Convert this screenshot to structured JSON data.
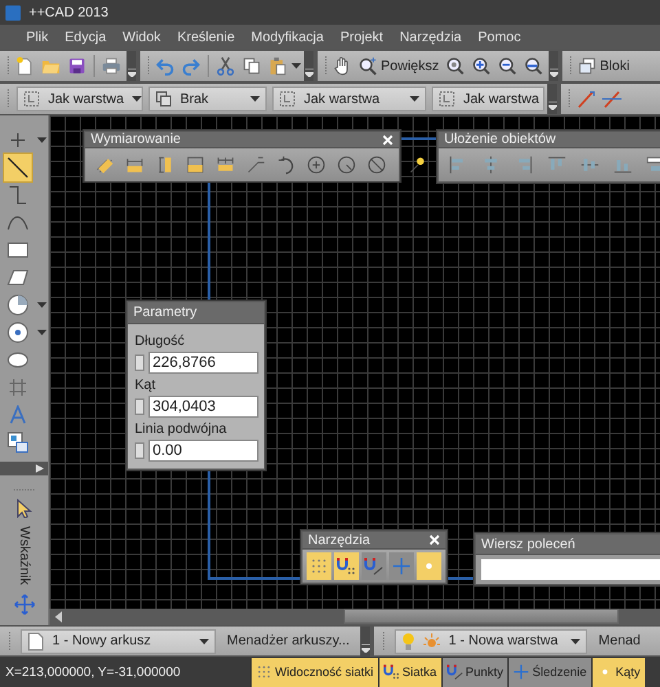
{
  "window": {
    "title": "++CAD 2013"
  },
  "menu": [
    "Plik",
    "Edycja",
    "Widok",
    "Kreślenie",
    "Modyfikacja",
    "Projekt",
    "Narzędzia",
    "Pomoc"
  ],
  "zoom_button": {
    "label": "Powiększ"
  },
  "blocks_button": {
    "label": "Bloki"
  },
  "property_combos": [
    {
      "kind": "layer",
      "value": "Jak warstwa"
    },
    {
      "kind": "stack",
      "value": "Brak"
    },
    {
      "kind": "layer",
      "value": "Jak warstwa"
    },
    {
      "kind": "layer",
      "value": "Jak warstwa"
    }
  ],
  "left_tools": [
    {
      "kind": "point",
      "selected": false
    },
    {
      "kind": "line",
      "selected": true
    },
    {
      "kind": "polyline",
      "selected": false
    },
    {
      "kind": "arc",
      "selected": false
    },
    {
      "kind": "rectangle",
      "selected": false
    },
    {
      "kind": "parallelogram",
      "selected": false
    },
    {
      "kind": "pie",
      "selected": false
    },
    {
      "kind": "circle",
      "selected": false
    },
    {
      "kind": "ellipse",
      "selected": false
    },
    {
      "kind": "hatch",
      "selected": false
    },
    {
      "kind": "text",
      "selected": false
    },
    {
      "kind": "image",
      "selected": false
    }
  ],
  "pointer_tool": {
    "label": "Wskaźnik"
  },
  "dimension_panel": {
    "title": "Wymiarowanie"
  },
  "arrange_panel": {
    "title": "Ułożenie obiektów"
  },
  "parameters_panel": {
    "title": "Parametry",
    "fields": [
      {
        "label": "Długość",
        "checked": false,
        "value": "226,8766"
      },
      {
        "label": "Kąt",
        "checked": false,
        "value": "304,0403"
      },
      {
        "label": "Linia podwójna",
        "checked": false,
        "value": "0.00"
      }
    ]
  },
  "tools_panel": {
    "title": "Narzędzia",
    "toggles": [
      {
        "kind": "grid",
        "on": true
      },
      {
        "kind": "snap",
        "on": true
      },
      {
        "kind": "points",
        "on": false
      },
      {
        "kind": "tracking",
        "on": false
      },
      {
        "kind": "angles",
        "on": true
      }
    ]
  },
  "command_panel": {
    "title": "Wiersz poleceń"
  },
  "sheet_bar": {
    "sheet": "1 - Nowy arkusz",
    "sheet_manager": "Menadżer arkuszy...",
    "layer": "1 - Nowa warstwa",
    "layer_manager": "Menad"
  },
  "status_bar": {
    "coordinates": "X=213,000000, Y=-31,000000",
    "toggles": [
      {
        "kind": "grid",
        "label": "Widoczność siatki",
        "on": true
      },
      {
        "kind": "snap",
        "label": "Siatka",
        "on": true
      },
      {
        "kind": "points",
        "label": "Punkty",
        "on": false
      },
      {
        "kind": "tracking",
        "label": "Śledzenie",
        "on": false
      },
      {
        "kind": "angles",
        "label": "Kąty",
        "on": true
      }
    ]
  }
}
